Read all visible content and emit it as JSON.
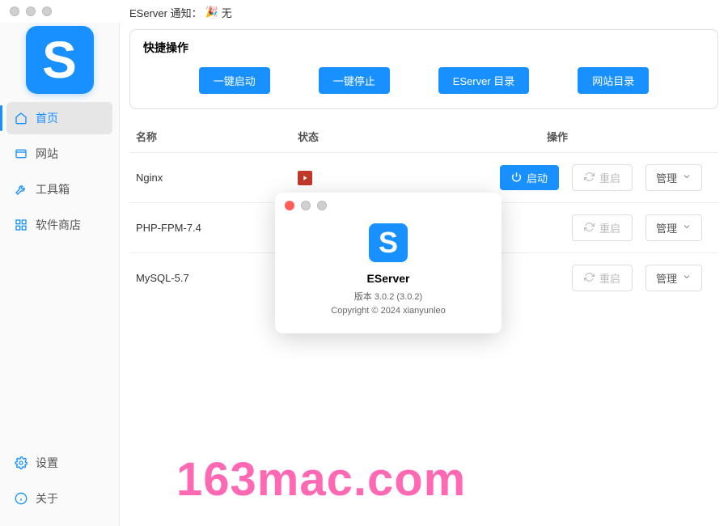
{
  "notice": {
    "prefix": "EServer 通知：",
    "emoji": "🎉",
    "text": "无"
  },
  "sidebar": {
    "logo_letter": "S",
    "items": [
      {
        "label": "首页",
        "icon": "home-icon"
      },
      {
        "label": "网站",
        "icon": "window-icon"
      },
      {
        "label": "工具箱",
        "icon": "wrench-icon"
      },
      {
        "label": "软件商店",
        "icon": "grid-icon"
      }
    ],
    "bottom": [
      {
        "label": "设置",
        "icon": "gear-icon"
      },
      {
        "label": "关于",
        "icon": "info-icon"
      }
    ]
  },
  "quick": {
    "title": "快捷操作",
    "buttons": [
      "一键启动",
      "一键停止",
      "EServer 目录",
      "网站目录"
    ]
  },
  "table": {
    "headers": {
      "name": "名称",
      "status": "状态",
      "actions": "操作"
    },
    "rows": [
      {
        "name": "Nginx"
      },
      {
        "name": "PHP-FPM-7.4"
      },
      {
        "name": "MySQL-5.7"
      }
    ],
    "action_labels": {
      "start": "启动",
      "restart": "重启",
      "manage": "管理"
    }
  },
  "about": {
    "logo_letter": "S",
    "title": "EServer",
    "version": "版本 3.0.2 (3.0.2)",
    "copyright": "Copyright © 2024 xianyunleo"
  },
  "watermark": "163mac.com"
}
